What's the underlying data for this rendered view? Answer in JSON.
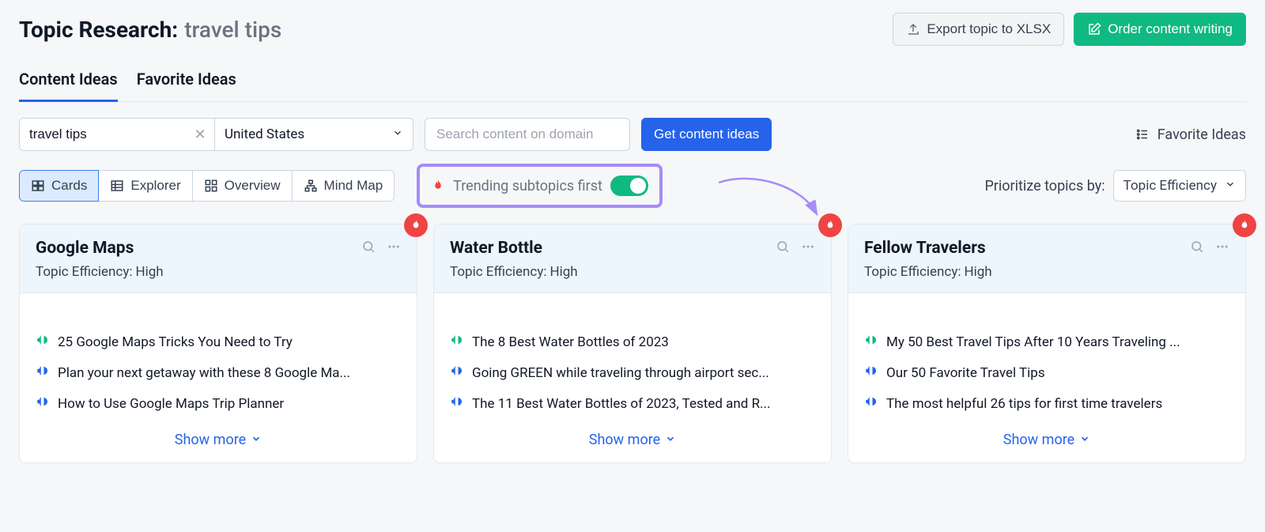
{
  "header": {
    "title_prefix": "Topic Research:",
    "topic": "travel tips",
    "export_label": "Export topic to XLSX",
    "order_label": "Order content writing"
  },
  "tabs": [
    {
      "label": "Content Ideas",
      "active": true
    },
    {
      "label": "Favorite Ideas",
      "active": false
    }
  ],
  "controls": {
    "topic_input_value": "travel tips",
    "region_value": "United States",
    "search_domain_placeholder": "Search content on domain",
    "get_ideas_label": "Get content ideas",
    "favorite_ideas_label": "Favorite Ideas"
  },
  "views": [
    {
      "label": "Cards",
      "active": true
    },
    {
      "label": "Explorer",
      "active": false
    },
    {
      "label": "Overview",
      "active": false
    },
    {
      "label": "Mind Map",
      "active": false
    }
  ],
  "trending": {
    "label": "Trending subtopics first",
    "on": true
  },
  "prioritize": {
    "label": "Prioritize topics by:",
    "value": "Topic Efficiency"
  },
  "cards": [
    {
      "title": "Google Maps",
      "efficiency_label": "Topic Efficiency:",
      "efficiency_value": "High",
      "headlines": [
        {
          "text": "25 Google Maps Tricks You Need to Try",
          "color": "green"
        },
        {
          "text": "Plan your next getaway with these 8 Google Ma...",
          "color": "blue"
        },
        {
          "text": "How to Use Google Maps Trip Planner",
          "color": "blue"
        }
      ],
      "show_more": "Show more"
    },
    {
      "title": "Water Bottle",
      "efficiency_label": "Topic Efficiency:",
      "efficiency_value": "High",
      "headlines": [
        {
          "text": "The 8 Best Water Bottles of 2023",
          "color": "green"
        },
        {
          "text": "Going GREEN while traveling through airport sec...",
          "color": "blue"
        },
        {
          "text": "The 11 Best Water Bottles of 2023, Tested and R...",
          "color": "blue"
        }
      ],
      "show_more": "Show more"
    },
    {
      "title": "Fellow Travelers",
      "efficiency_label": "Topic Efficiency:",
      "efficiency_value": "High",
      "headlines": [
        {
          "text": "My 50 Best Travel Tips After 10 Years Traveling ...",
          "color": "green"
        },
        {
          "text": "Our 50 Favorite Travel Tips",
          "color": "blue"
        },
        {
          "text": "The most helpful 26 tips for first time travelers",
          "color": "blue"
        }
      ],
      "show_more": "Show more"
    }
  ]
}
